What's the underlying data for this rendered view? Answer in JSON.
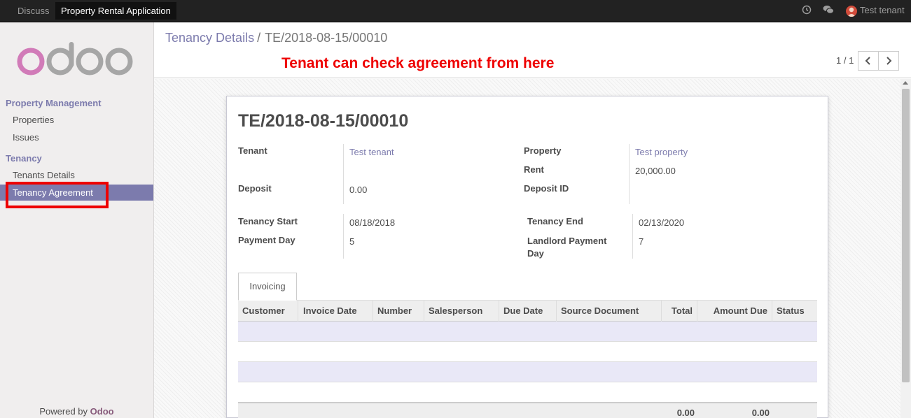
{
  "topbar": {
    "apps": [
      "Discuss",
      "Property Rental Application"
    ],
    "user_name": "Test tenant"
  },
  "sidebar": {
    "logo_text": "odoo",
    "sections": [
      {
        "title": "Property Management",
        "items": [
          "Properties",
          "Issues"
        ]
      },
      {
        "title": "Tenancy",
        "items": [
          "Tenants Details",
          "Tenancy Agreement"
        ]
      }
    ],
    "active_item": "Tenancy Agreement",
    "powered_prefix": "Powered by",
    "powered_brand": "Odoo"
  },
  "control_panel": {
    "breadcrumb": {
      "parent": "Tenancy Details",
      "separator": "/",
      "current": "TE/2018-08-15/00010"
    },
    "annotation": "Tenant can check agreement from here",
    "pager": {
      "value": "1 / 1"
    }
  },
  "record": {
    "title": "TE/2018-08-15/00010",
    "fields": {
      "tenant": {
        "label": "Tenant",
        "value": "Test tenant"
      },
      "deposit": {
        "label": "Deposit",
        "value": "0.00"
      },
      "property": {
        "label": "Property",
        "value": "Test property"
      },
      "rent": {
        "label": "Rent",
        "value": "20,000.00"
      },
      "deposit_id": {
        "label": "Deposit ID",
        "value": ""
      },
      "tenancy_start": {
        "label": "Tenancy Start",
        "value": "08/18/2018"
      },
      "payment_day": {
        "label": "Payment Day",
        "value": "5"
      },
      "tenancy_end": {
        "label": "Tenancy End",
        "value": "02/13/2020"
      },
      "landlord_payment_day": {
        "label": "Landlord Payment Day",
        "value": "7"
      }
    },
    "tabs": [
      "Invoicing"
    ],
    "invoice_table": {
      "columns": [
        "Customer",
        "Invoice Date",
        "Number",
        "Salesperson",
        "Due Date",
        "Source Document",
        "Total",
        "Amount Due",
        "Status"
      ],
      "rows": [],
      "footer": {
        "total": "0.00",
        "amount_due": "0.00"
      }
    }
  },
  "colors": {
    "accent": "#7c7bad",
    "brand": "#875a7b",
    "annotation": "#ee0000",
    "topbar": "#222222"
  }
}
